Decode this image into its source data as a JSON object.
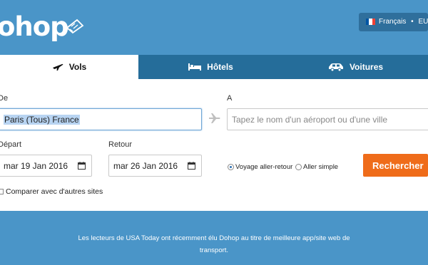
{
  "header": {
    "logo_text": "ohop",
    "language": "Français",
    "separator": "•",
    "currency": "EUR",
    "flag_colors": [
      "#0055a4",
      "#ffffff",
      "#ef4135"
    ]
  },
  "tabs": [
    {
      "label": "Vols",
      "icon": "plane-icon",
      "active": true
    },
    {
      "label": "Hôtels",
      "icon": "bed-icon",
      "active": false
    },
    {
      "label": "Voitures",
      "icon": "car-icon",
      "active": false
    }
  ],
  "form": {
    "from_label": "De",
    "from_value": "Paris (Tous) France",
    "to_label": "A",
    "to_placeholder": "Tapez le nom d'un aéroport ou d'une ville",
    "depart_label": "Départ",
    "depart_value": "mar 19 Jan 2016",
    "return_label": "Retour",
    "return_value": "mar 26 Jan 2016",
    "trip_options": [
      {
        "label": "Voyage aller-retour",
        "selected": true
      },
      {
        "label": "Aller simple",
        "selected": false
      }
    ],
    "search_button": "Rechercher",
    "compare_label": "Comparer avec d'autres sites",
    "compare_checked": false
  },
  "footer": {
    "text": "Les lecteurs de USA Today ont récemment élu Dohop au titre de meilleure app/site web de transport."
  },
  "colors": {
    "header_bg": "#4a95c8",
    "tab_inactive": "#256d9a",
    "search_button": "#ef6c1a"
  }
}
